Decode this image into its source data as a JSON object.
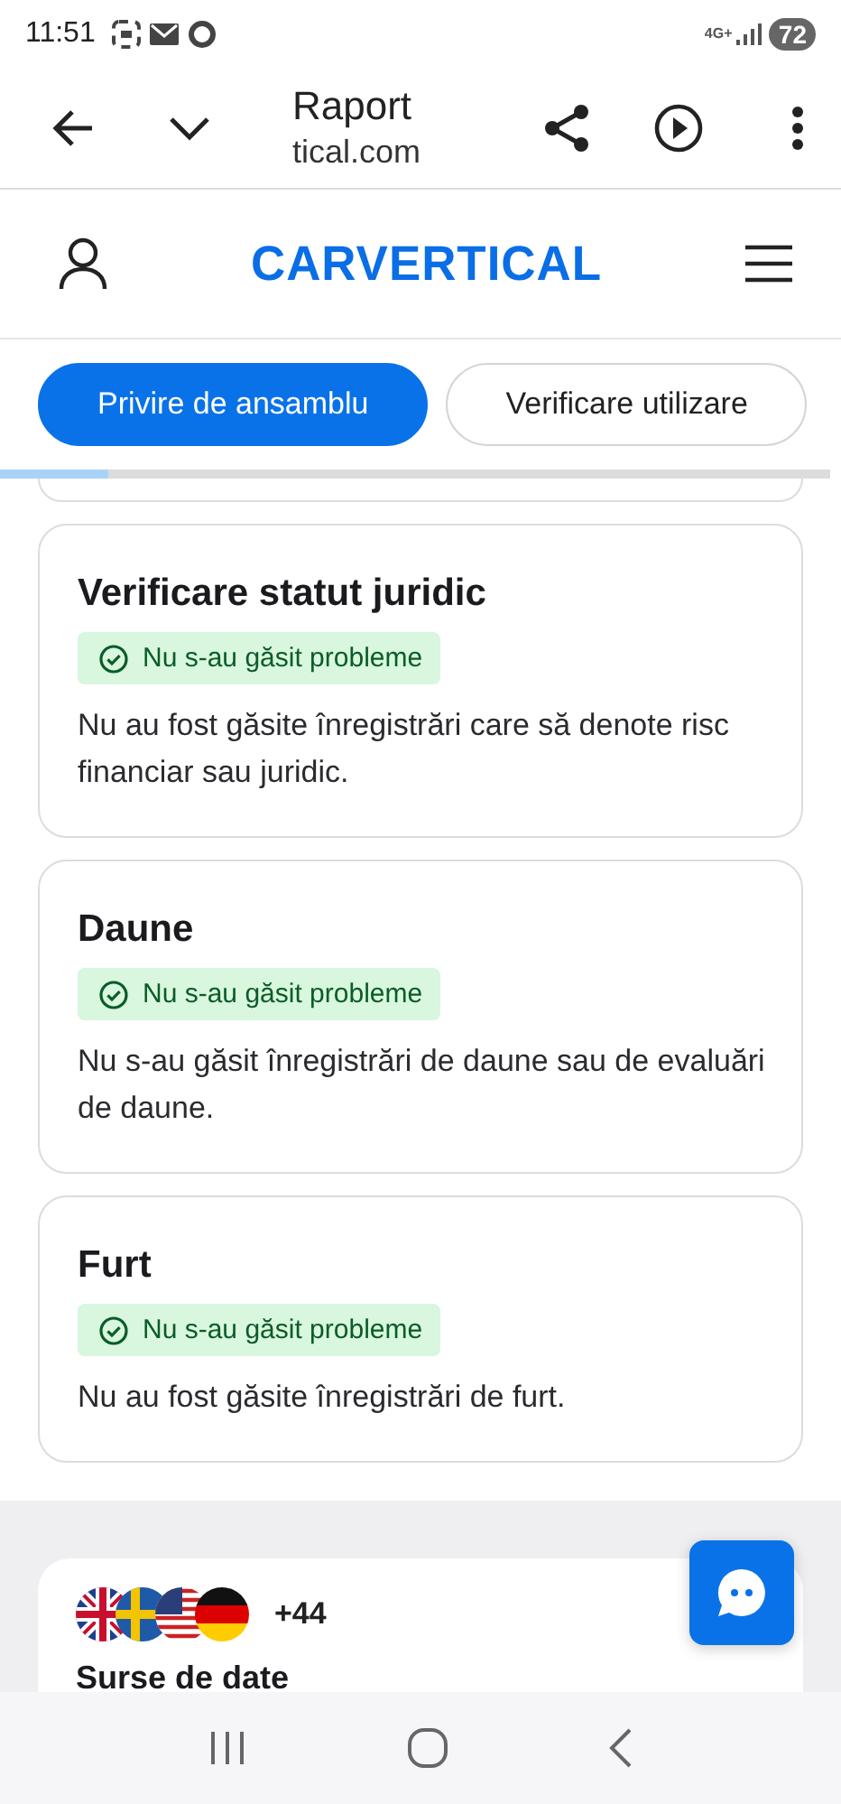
{
  "status_bar": {
    "time": "11:51",
    "network": "4G+",
    "battery": "72"
  },
  "browser": {
    "title": "Raport",
    "url": "tical.com"
  },
  "site": {
    "logo": "CARVERTICAL"
  },
  "tabs": [
    {
      "label": "Privire de ansamblu",
      "selected": true
    },
    {
      "label": "Verificare utilizare",
      "selected": false
    }
  ],
  "progress": {
    "level": 0.13
  },
  "checks": [
    {
      "title": "Verificare statut juridic",
      "badge": "Nu s-au găsit probleme",
      "text": "Nu au fost găsite înregistrări care să denote risc financiar sau juridic."
    },
    {
      "title": "Daune",
      "badge": "Nu s-au găsit probleme",
      "text": "Nu s-au găsit înregistrări de daune sau de evaluări de daune."
    },
    {
      "title": "Furt",
      "badge": "Nu s-au găsit probleme",
      "text": "Nu au fost găsite înregistrări de furt."
    }
  ],
  "sources": {
    "more": "+44",
    "title": "Surse de date"
  }
}
